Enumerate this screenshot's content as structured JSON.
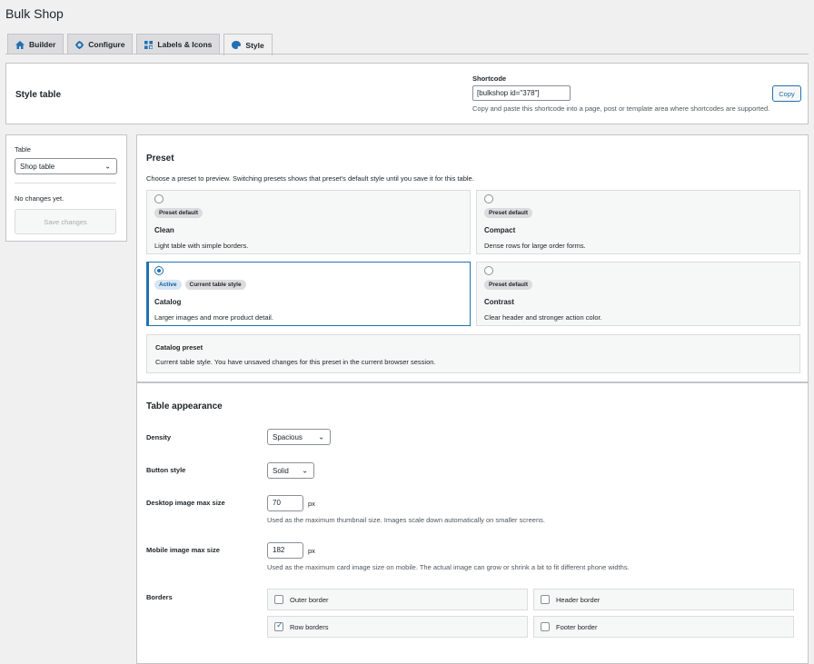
{
  "app": {
    "title": "Bulk Shop"
  },
  "tabs": [
    {
      "label": "Builder",
      "icon": "home-icon"
    },
    {
      "label": "Configure",
      "icon": "gear-icon"
    },
    {
      "label": "Labels & Icons",
      "icon": "tag-icon"
    },
    {
      "label": "Style",
      "icon": "palette-icon",
      "active": true
    }
  ],
  "header": {
    "title": "Style table",
    "shortcode_label": "Shortcode",
    "shortcode_value": "[bulkshop id=\"378\"]",
    "copy_label": "Copy",
    "shortcode_help": "Copy and paste this shortcode into a page, post or template area where shortcodes are supported."
  },
  "sidebar": {
    "table_label": "Table",
    "table_selected": "Shop table",
    "status": "No changes yet.",
    "save_label": "Save changes"
  },
  "preset": {
    "title": "Preset",
    "description": "Choose a preset to preview. Switching presets shows that preset's default style until you save it for this table.",
    "cards": [
      {
        "badges": [
          "Preset default"
        ],
        "name": "Clean",
        "desc": "Light table with simple borders.",
        "selected": false
      },
      {
        "badges": [
          "Preset default"
        ],
        "name": "Compact",
        "desc": "Dense rows for large order forms.",
        "selected": false
      },
      {
        "badges": [
          "Active",
          "Current table style"
        ],
        "name": "Catalog",
        "desc": "Larger images and more product detail.",
        "selected": true
      },
      {
        "badges": [
          "Preset default"
        ],
        "name": "Contrast",
        "desc": "Clear header and stronger action color.",
        "selected": false
      }
    ],
    "note_title": "Catalog preset",
    "note_text": "Current table style. You have unsaved changes for this preset in the current browser session."
  },
  "appearance": {
    "title": "Table appearance",
    "density_label": "Density",
    "density_value": "Spacious",
    "button_style_label": "Button style",
    "button_style_value": "Solid",
    "desktop_label": "Desktop image max size",
    "desktop_value": "70",
    "desktop_unit": "px",
    "desktop_help": "Used as the maximum thumbnail size. Images scale down automatically on smaller screens.",
    "mobile_label": "Mobile image max size",
    "mobile_value": "182",
    "mobile_unit": "px",
    "mobile_help": "Used as the maximum card image size on mobile. The actual image can grow or shrink a bit to fit different phone widths.",
    "borders_label": "Borders",
    "borders": [
      {
        "label": "Outer border",
        "checked": false
      },
      {
        "label": "Header border",
        "checked": false
      },
      {
        "label": "Row borders",
        "checked": true
      },
      {
        "label": "Footer border",
        "checked": false
      }
    ]
  },
  "colors": {
    "accent": "#2271b1",
    "background": "#f0f0f1"
  }
}
